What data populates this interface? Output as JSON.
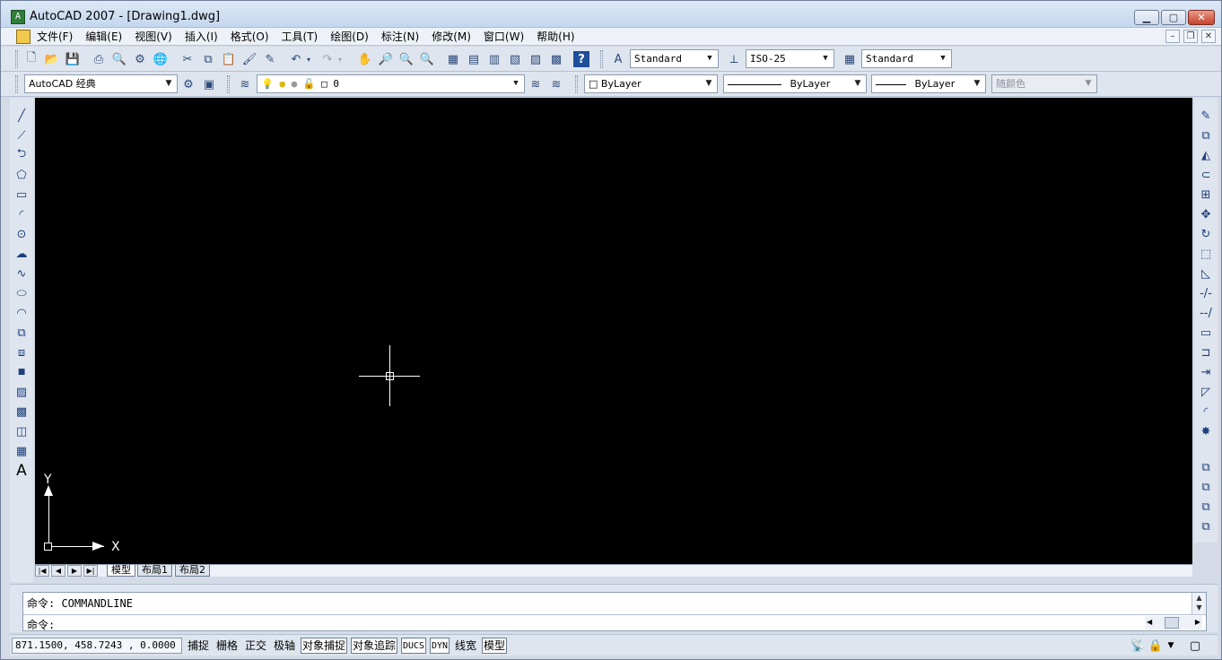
{
  "window": {
    "title": "AutoCAD 2007 - [Drawing1.dwg]",
    "icon_label": "A"
  },
  "menu": {
    "items": [
      "文件(F)",
      "编辑(E)",
      "视图(V)",
      "插入(I)",
      "格式(O)",
      "工具(T)",
      "绘图(D)",
      "标注(N)",
      "修改(M)",
      "窗口(W)",
      "帮助(H)"
    ]
  },
  "toolbar1": {
    "text_style": "Standard",
    "dim_style": "ISO-25",
    "table_style": "Standard"
  },
  "toolbar2": {
    "workspace": "AutoCAD 经典",
    "layer": "0",
    "color": "ByLayer",
    "linetype": "ByLayer",
    "lineweight": "ByLayer",
    "plot_style": "随颜色"
  },
  "canvas": {
    "background": "#000000",
    "ucs_x_label": "X",
    "ucs_y_label": "Y"
  },
  "layout_tabs": [
    "模型",
    "布局1",
    "布局2"
  ],
  "command": {
    "history": "命令: COMMANDLINE",
    "prompt": "命令:"
  },
  "status": {
    "coordinates": "871.1500,  458.7243 , 0.0000",
    "toggles": [
      {
        "label": "捕捉",
        "on": false
      },
      {
        "label": "栅格",
        "on": false
      },
      {
        "label": "正交",
        "on": false
      },
      {
        "label": "极轴",
        "on": false
      },
      {
        "label": "对象捕捉",
        "on": true
      },
      {
        "label": "对象追踪",
        "on": true
      },
      {
        "label": "DUCS",
        "on": true
      },
      {
        "label": "DYN",
        "on": true
      },
      {
        "label": "线宽",
        "on": false
      },
      {
        "label": "模型",
        "on": true
      }
    ]
  }
}
